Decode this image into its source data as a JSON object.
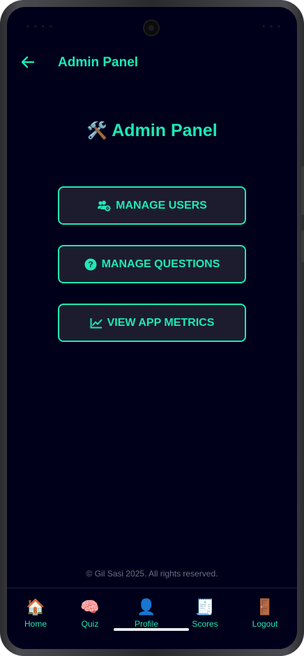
{
  "header": {
    "title": "Admin Panel"
  },
  "main": {
    "title_emoji": "🛠️",
    "title": "Admin Panel",
    "buttons": [
      {
        "label": "MANAGE USERS",
        "icon": "users-cog-icon"
      },
      {
        "label": "MANAGE QUESTIONS",
        "icon": "question-circle-icon"
      },
      {
        "label": "VIEW APP METRICS",
        "icon": "line-chart-icon"
      }
    ]
  },
  "footer": {
    "copyright": "© Gil Sasi 2025. All rights reserved."
  },
  "nav": {
    "items": [
      {
        "label": "Home",
        "icon": "🏠"
      },
      {
        "label": "Quiz",
        "icon": "🧠"
      },
      {
        "label": "Profile",
        "icon": "👤"
      },
      {
        "label": "Scores",
        "icon": "🧾"
      },
      {
        "label": "Logout",
        "icon": "🚪"
      }
    ]
  },
  "colors": {
    "accent": "#1de9b6",
    "background": "#00001a",
    "button_bg": "#1c1c2e"
  }
}
